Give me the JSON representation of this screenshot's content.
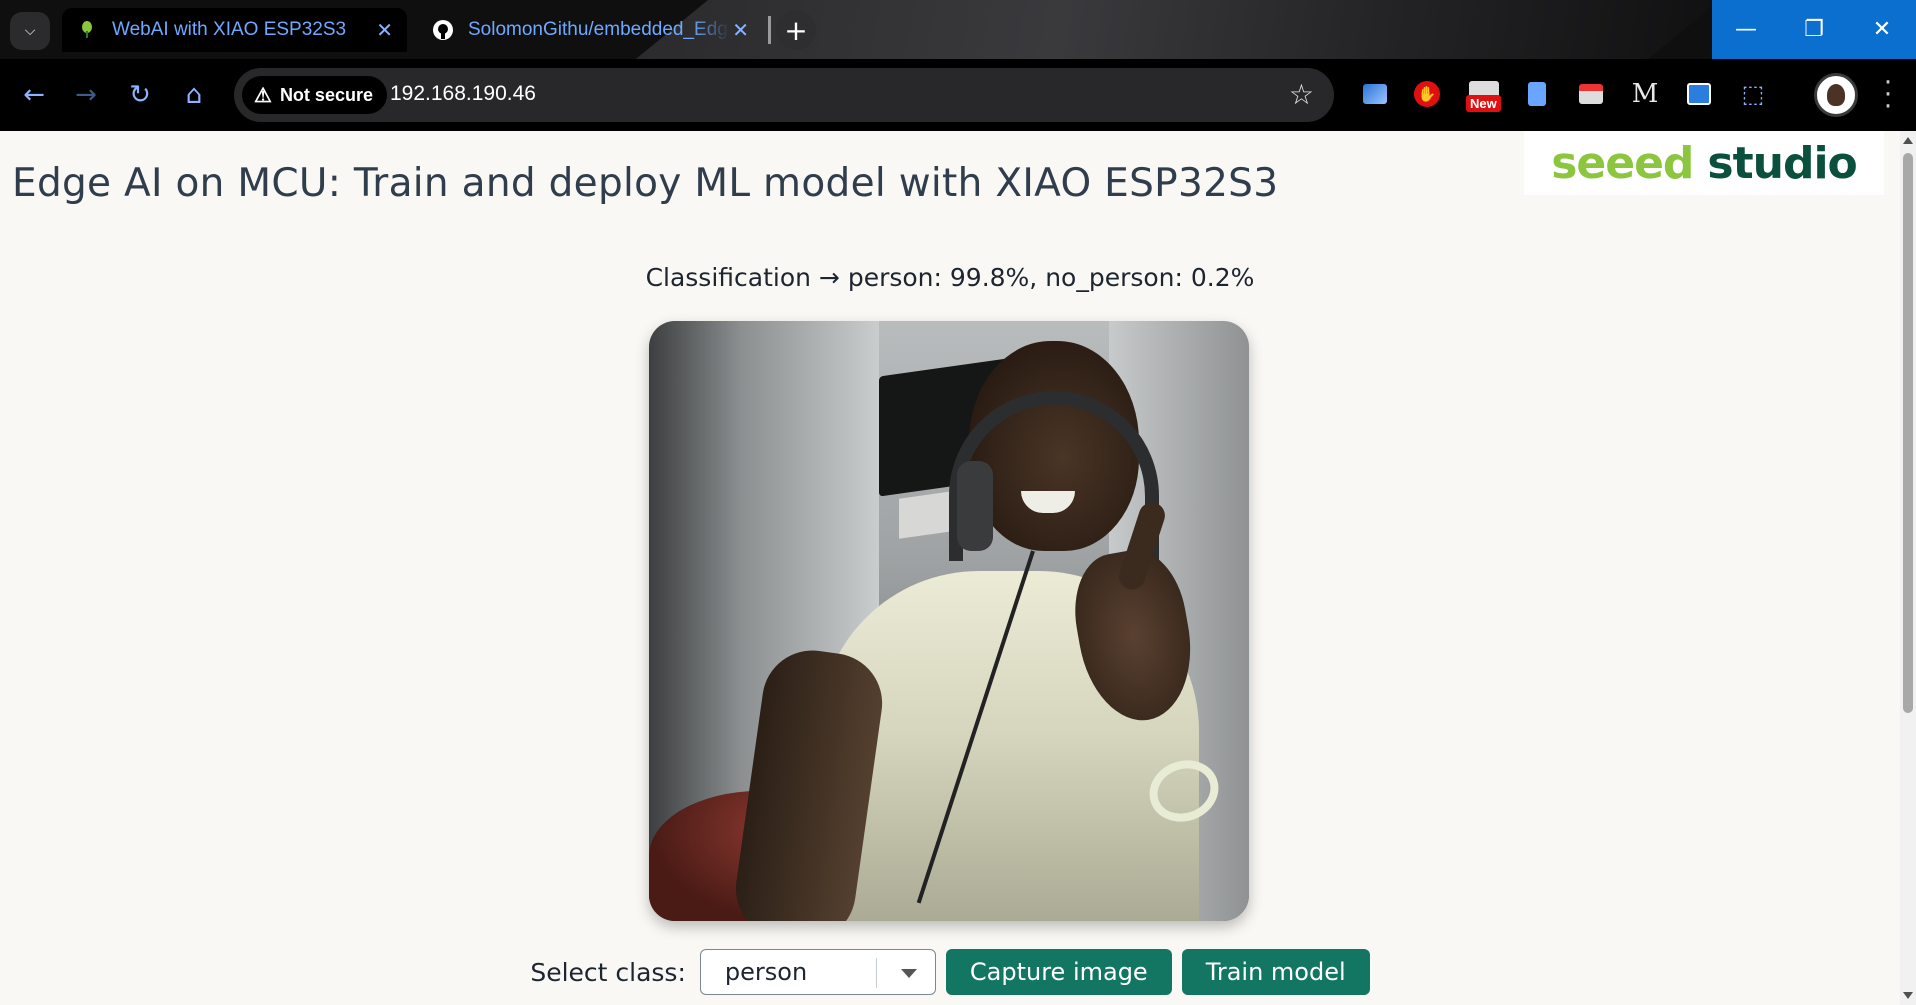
{
  "browser": {
    "tabs": [
      {
        "title": "WebAI with XIAO ESP32S3",
        "favicon": "leaf-icon",
        "active": true
      },
      {
        "title": "SolomonGithu/embedded_Edg",
        "favicon": "github-icon",
        "active": false
      }
    ],
    "security_label": "Not secure",
    "url": "192.168.190.46",
    "extension_badge": "New",
    "accent_color": "#0b6fd0"
  },
  "page": {
    "title": "Edge AI on MCU: Train and deploy ML model with XIAO ESP32S3",
    "logo": {
      "part1": "seeed",
      "part2": "studio"
    },
    "classification": "Classification → person: 99.8%, no_person: 0.2%",
    "select_label": "Select class:",
    "selected_class": "person",
    "capture_button": "Capture image",
    "train_button": "Train model",
    "button_color": "#127663"
  }
}
